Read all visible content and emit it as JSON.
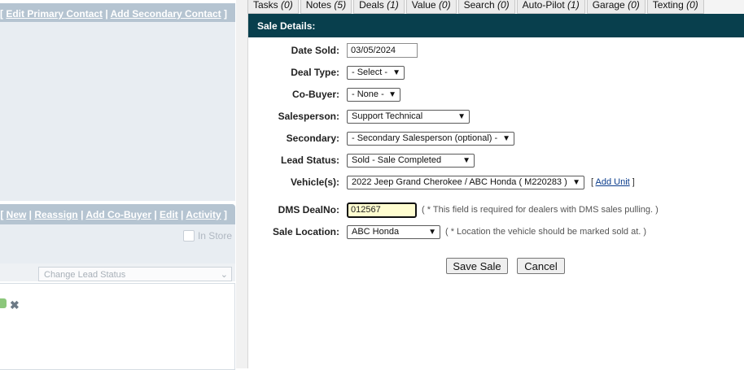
{
  "left_panel": {
    "top_header": {
      "links": [
        "Edit Primary Contact",
        "Add Secondary Contact"
      ]
    },
    "lead_header": {
      "links": [
        "New",
        "Reassign",
        "Add Co-Buyer",
        "Edit",
        "Activity"
      ]
    },
    "in_store_label": "In Store",
    "lead_status_select": "Change Lead Status"
  },
  "tabs": [
    {
      "label": "Tasks",
      "count": "(0)"
    },
    {
      "label": "Notes",
      "count": "(5)"
    },
    {
      "label": "Deals",
      "count": "(1)"
    },
    {
      "label": "Value",
      "count": "(0)"
    },
    {
      "label": "Search",
      "count": "(0)"
    },
    {
      "label": "Auto-Pilot",
      "count": "(1)"
    },
    {
      "label": "Garage",
      "count": "(0)"
    },
    {
      "label": "Texting",
      "count": "(0)"
    }
  ],
  "sale": {
    "title": "Sale Details:",
    "date_sold": {
      "label": "Date Sold:",
      "value": "03/05/2024"
    },
    "deal_type": {
      "label": "Deal Type:",
      "value": "- Select -"
    },
    "co_buyer": {
      "label": "Co-Buyer:",
      "value": "- None -"
    },
    "salesperson": {
      "label": "Salesperson:",
      "value": "Support Technical"
    },
    "secondary": {
      "label": "Secondary:",
      "value": "- Secondary Salesperson (optional) -"
    },
    "lead_status": {
      "label": "Lead Status:",
      "value": "Sold - Sale Completed"
    },
    "vehicles": {
      "label": "Vehicle(s):",
      "value": "2022 Jeep Grand Cherokee / ABC Honda ( M220283 )",
      "add_unit": "Add Unit"
    },
    "dms_deal_no": {
      "label": "DMS DealNo:",
      "value": "012567",
      "hint": "( * This field is required for dealers with DMS sales pulling. )"
    },
    "sale_location": {
      "label": "Sale Location:",
      "value": "ABC Honda",
      "hint": "( * Location the vehicle should be marked sold at. )"
    },
    "save_label": "Save Sale",
    "cancel_label": "Cancel"
  },
  "icons": {
    "dropdown": "chevron-down-icon",
    "remove": "close-icon",
    "edit": "pencil-icon"
  }
}
